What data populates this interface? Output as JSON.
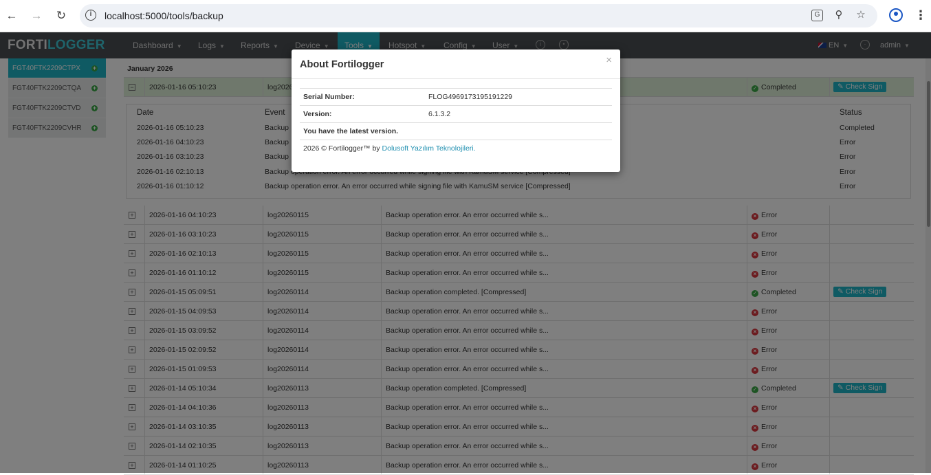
{
  "browser": {
    "url": "localhost:5000/tools/backup"
  },
  "navbar": {
    "logo_a": "FORTI",
    "logo_b": "LOGGER",
    "items": [
      {
        "label": "Dashboard"
      },
      {
        "label": "Logs"
      },
      {
        "label": "Reports"
      },
      {
        "label": "Device"
      },
      {
        "label": "Tools"
      },
      {
        "label": "Hotspot"
      },
      {
        "label": "Config"
      },
      {
        "label": "User"
      }
    ],
    "lang": "EN",
    "user": "admin"
  },
  "sidebar": {
    "items": [
      {
        "label": "FGT40FTK2209CTPX"
      },
      {
        "label": "FGT40FTK2209CTQA"
      },
      {
        "label": "FGT40FTK2209CTVD"
      },
      {
        "label": "FGT40FTK2209CVHR"
      }
    ]
  },
  "main": {
    "month": "January 2026",
    "expanded_row": {
      "date": "2026-01-16 05:10:23",
      "file": "log2026",
      "status": "Completed",
      "action": "Check Sign"
    },
    "detail": {
      "headers": {
        "date": "Date",
        "event": "Event",
        "status": "Status"
      },
      "rows": [
        {
          "date": "2026-01-16 05:10:23",
          "event": "Backup",
          "status": "Completed"
        },
        {
          "date": "2026-01-16 04:10:23",
          "event": "Backup",
          "status": "Error"
        },
        {
          "date": "2026-01-16 03:10:23",
          "event": "Backup",
          "status": "Error"
        },
        {
          "date": "2026-01-16 02:10:13",
          "event": "Backup operation error. An error occurred while signing file with KamuSM service [Compressed]",
          "status": "Error"
        },
        {
          "date": "2026-01-16 01:10:12",
          "event": "Backup operation error. An error occurred while signing file with KamuSM service [Compressed]",
          "status": "Error"
        }
      ]
    },
    "rows": [
      {
        "date": "2026-01-16 04:10:23",
        "file": "log20260115",
        "message": "Backup operation error. An error occurred while s...",
        "status": "Error",
        "ok": false
      },
      {
        "date": "2026-01-16 03:10:23",
        "file": "log20260115",
        "message": "Backup operation error. An error occurred while s...",
        "status": "Error",
        "ok": false
      },
      {
        "date": "2026-01-16 02:10:13",
        "file": "log20260115",
        "message": "Backup operation error. An error occurred while s...",
        "status": "Error",
        "ok": false
      },
      {
        "date": "2026-01-16 01:10:12",
        "file": "log20260115",
        "message": "Backup operation error. An error occurred while s...",
        "status": "Error",
        "ok": false
      },
      {
        "date": "2026-01-15 05:09:51",
        "file": "log20260114",
        "message": "Backup operation completed. [Compressed]",
        "status": "Completed",
        "ok": true,
        "action": "Check Sign"
      },
      {
        "date": "2026-01-15 04:09:53",
        "file": "log20260114",
        "message": "Backup operation error. An error occurred while s...",
        "status": "Error",
        "ok": false
      },
      {
        "date": "2026-01-15 03:09:52",
        "file": "log20260114",
        "message": "Backup operation error. An error occurred while s...",
        "status": "Error",
        "ok": false
      },
      {
        "date": "2026-01-15 02:09:52",
        "file": "log20260114",
        "message": "Backup operation error. An error occurred while s...",
        "status": "Error",
        "ok": false
      },
      {
        "date": "2026-01-15 01:09:53",
        "file": "log20260114",
        "message": "Backup operation error. An error occurred while s...",
        "status": "Error",
        "ok": false
      },
      {
        "date": "2026-01-14 05:10:34",
        "file": "log20260113",
        "message": "Backup operation completed. [Compressed]",
        "status": "Completed",
        "ok": true,
        "action": "Check Sign"
      },
      {
        "date": "2026-01-14 04:10:36",
        "file": "log20260113",
        "message": "Backup operation error. An error occurred while s...",
        "status": "Error",
        "ok": false
      },
      {
        "date": "2026-01-14 03:10:35",
        "file": "log20260113",
        "message": "Backup operation error. An error occurred while s...",
        "status": "Error",
        "ok": false
      },
      {
        "date": "2026-01-14 02:10:35",
        "file": "log20260113",
        "message": "Backup operation error. An error occurred while s...",
        "status": "Error",
        "ok": false
      },
      {
        "date": "2026-01-14 01:10:25",
        "file": "log20260113",
        "message": "Backup operation error. An error occurred while s...",
        "status": "Error",
        "ok": false
      }
    ]
  },
  "modal": {
    "title": "About Fortilogger",
    "close": "×",
    "serial_label": "Serial Number:",
    "serial_value": "FLOG4969173195191229",
    "version_label": "Version:",
    "version_value": "6.1.3.2",
    "latest": "You have the latest version.",
    "copyright_prefix": "2026 © Fortilogger™ by ",
    "copyright_link": "Dolusoft Yazılım Teknolojileri."
  },
  "colors": {
    "accent": "#1fb5c6",
    "navbar": "#4a4f53",
    "success": "#3ba847",
    "error": "#d9363e",
    "expanded_row": "#dff0d8"
  }
}
